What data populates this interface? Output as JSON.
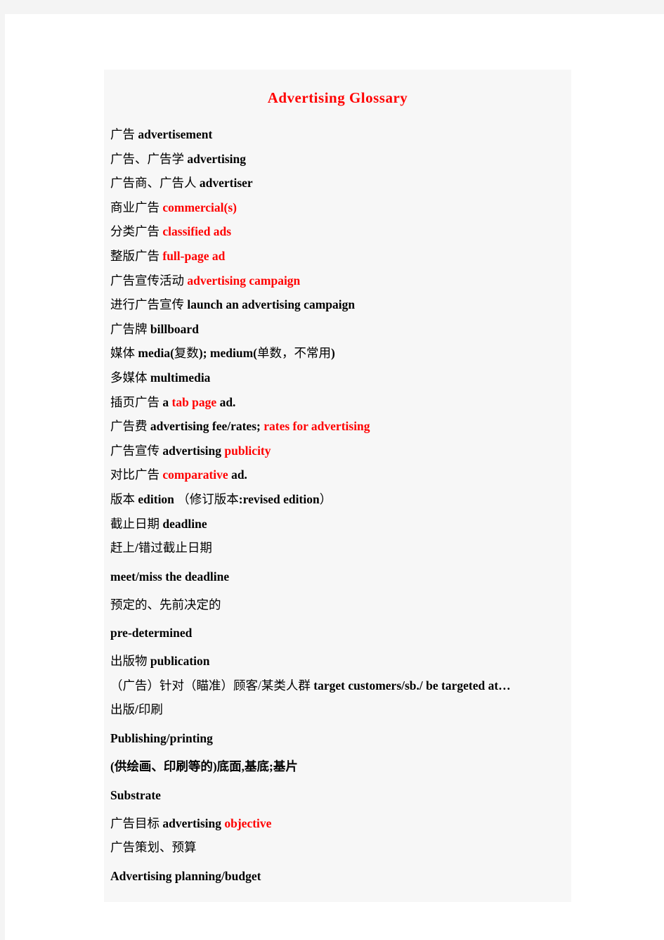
{
  "document": {
    "title": "Advertising  Glossary",
    "title_color": "#ff0000",
    "background_color": "#f7f7f7",
    "page_color": "#ffffff",
    "canvas_color": "#f4f4f4"
  },
  "entries": [
    {
      "id": "advertisement",
      "segments": [
        {
          "text": "广告  ",
          "style": "zh"
        },
        {
          "text": "advertisement",
          "style": "en"
        }
      ]
    },
    {
      "id": "advertising",
      "segments": [
        {
          "text": "广告、广告学   ",
          "style": "zh"
        },
        {
          "text": "advertising",
          "style": "en"
        }
      ]
    },
    {
      "id": "advertiser",
      "segments": [
        {
          "text": "广告商、广告人  ",
          "style": "zh"
        },
        {
          "text": "advertiser",
          "style": "en"
        }
      ]
    },
    {
      "id": "commercials",
      "segments": [
        {
          "text": "商业广告     ",
          "style": "zh"
        },
        {
          "text": "commercial(s)",
          "style": "en red"
        }
      ]
    },
    {
      "id": "classified-ads",
      "segments": [
        {
          "text": "分类广告     ",
          "style": "zh"
        },
        {
          "text": "classified  ads",
          "style": "en red"
        }
      ]
    },
    {
      "id": "full-page-ad",
      "segments": [
        {
          "text": "整版广告       ",
          "style": "zh"
        },
        {
          "text": "full-page  ad",
          "style": "en red"
        }
      ]
    },
    {
      "id": "advertising-campaign",
      "segments": [
        {
          "text": "广告宣传活动    ",
          "style": "zh"
        },
        {
          "text": "advertising  campaign",
          "style": "en red"
        }
      ]
    },
    {
      "id": "launch-campaign",
      "segments": [
        {
          "text": "进行广告宣传   ",
          "style": "zh"
        },
        {
          "text": "launch  an  advertising  campaign",
          "style": "en"
        }
      ]
    },
    {
      "id": "billboard",
      "segments": [
        {
          "text": "广告牌         ",
          "style": "zh"
        },
        {
          "text": "billboard",
          "style": "en"
        }
      ]
    },
    {
      "id": "media",
      "segments": [
        {
          "text": "媒体   ",
          "style": "zh"
        },
        {
          "text": "media(",
          "style": "en"
        },
        {
          "text": "复数",
          "style": "zh"
        },
        {
          "text": ");  medium(",
          "style": "en"
        },
        {
          "text": "单数，不常用",
          "style": "zh"
        },
        {
          "text": ")",
          "style": "en"
        }
      ]
    },
    {
      "id": "multimedia",
      "segments": [
        {
          "text": "多媒体   ",
          "style": "zh"
        },
        {
          "text": "multimedia",
          "style": "en"
        }
      ]
    },
    {
      "id": "tab-page-ad",
      "segments": [
        {
          "text": "插页广告   ",
          "style": "zh"
        },
        {
          "text": "a ",
          "style": "en"
        },
        {
          "text": "tab  page",
          "style": "en red"
        },
        {
          "text": " ad.",
          "style": "en"
        }
      ]
    },
    {
      "id": "advertising-fee",
      "segments": [
        {
          "text": "广告费 ",
          "style": "zh"
        },
        {
          "text": "advertising  fee/rates; ",
          "style": "en"
        },
        {
          "text": "rates  for  advertising",
          "style": "en red"
        }
      ]
    },
    {
      "id": "advertising-publicity",
      "segments": [
        {
          "text": "广告宣传     ",
          "style": "zh"
        },
        {
          "text": "advertising  ",
          "style": "en"
        },
        {
          "text": "publicity",
          "style": "en red"
        }
      ]
    },
    {
      "id": "comparative-ad",
      "segments": [
        {
          "text": "对比广告  ",
          "style": "zh"
        },
        {
          "text": "comparative",
          "style": "en red"
        },
        {
          "text": "  ad.",
          "style": "en"
        }
      ]
    },
    {
      "id": "edition",
      "segments": [
        {
          "text": "版本 ",
          "style": "zh"
        },
        {
          "text": "edition",
          "style": "en"
        },
        {
          "text": "   （修订版本",
          "style": "zh"
        },
        {
          "text": ":revised  edition",
          "style": "en"
        },
        {
          "text": "）",
          "style": "zh"
        }
      ]
    },
    {
      "id": "deadline",
      "segments": [
        {
          "text": "截止日期  ",
          "style": "zh"
        },
        {
          "text": "deadline",
          "style": "en"
        }
      ]
    },
    {
      "id": "meet-miss-deadline-zh",
      "segments": [
        {
          "text": "赶上",
          "style": "zh"
        },
        {
          "text": "/",
          "style": "en"
        },
        {
          "text": "错过截止日期",
          "style": "zh"
        }
      ]
    },
    {
      "id": "meet-miss-deadline-en",
      "loose": true,
      "segments": [
        {
          "text": "meet/miss  the  deadline",
          "style": "en"
        }
      ]
    },
    {
      "id": "pre-determined-zh",
      "segments": [
        {
          "text": "预定的、先前决定的",
          "style": "zh"
        }
      ]
    },
    {
      "id": "pre-determined-en",
      "loose": true,
      "segments": [
        {
          "text": "pre-determined",
          "style": "en"
        }
      ]
    },
    {
      "id": "publication",
      "segments": [
        {
          "text": "出版物        ",
          "style": "zh"
        },
        {
          "text": "publication",
          "style": "en"
        }
      ]
    },
    {
      "id": "target-customers",
      "segments": [
        {
          "text": "（广告）针对（瞄准）顾客/某类人群   ",
          "style": "zh"
        },
        {
          "text": "target  customers/sb./  be  targeted  at…",
          "style": "en"
        }
      ]
    },
    {
      "id": "publishing-printing-zh",
      "segments": [
        {
          "text": "出版",
          "style": "zh"
        },
        {
          "text": "/",
          "style": "en"
        },
        {
          "text": "印刷",
          "style": "zh"
        }
      ]
    },
    {
      "id": "publishing-printing-en",
      "loose": true,
      "segments": [
        {
          "text": "Publishing/printing",
          "style": "en"
        }
      ]
    },
    {
      "id": "substrate-zh",
      "segments": [
        {
          "text": "(供绘画、印刷等的)底面,基底;基片",
          "style": "zh zh-bold"
        }
      ]
    },
    {
      "id": "substrate-en",
      "loose": true,
      "segments": [
        {
          "text": "Substrate",
          "style": "en"
        }
      ]
    },
    {
      "id": "advertising-objective",
      "segments": [
        {
          "text": "广告目标   ",
          "style": "zh"
        },
        {
          "text": "advertising  ",
          "style": "en"
        },
        {
          "text": "objective",
          "style": "en red"
        }
      ]
    },
    {
      "id": "advertising-planning-zh",
      "segments": [
        {
          "text": "广告策划、预算",
          "style": "zh"
        }
      ]
    },
    {
      "id": "advertising-planning-en",
      "loose": true,
      "segments": [
        {
          "text": "Advertising  planning/budget",
          "style": "en"
        }
      ]
    }
  ]
}
